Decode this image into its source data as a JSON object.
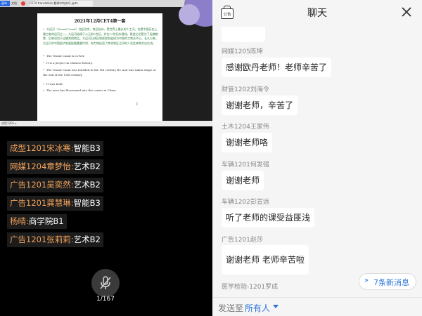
{
  "shared_screen": {
    "toolbar": {
      "file_tab": "画布",
      "tab1": "文档",
      "tab2": "CET4 translation 翻译中的技巧.pptx",
      "controls": "— □ ✕"
    },
    "slide": {
      "title": "2021年12月CET4第一套",
      "bullets": [
        "大运河（Grand Canal）北起北京，南至杭州，是世界上最长的人工河，也是中国历史上最古老的运河之一。大运河始建于公元前5世纪，并在13世纪末建成。建造之初是为了运输粮食，后来也用于运输其他商品。大运河沿线区域逐渐发展成为中国的工商业中心。长久以来，大运河对中国经济发展起着重要作用，有力地促进了南北地区之间的人员往来和文化交流。",
        "The Grand Canal is a river.",
        "It is a project in Chinese history.",
        "The Grand Canal was founded in the 5th century BC and was taken shape at the end of the 13th century.",
        "It was built.",
        "The area has blossomed into the center in China."
      ]
    },
    "video_bar_text": "成型1201 ▸"
  },
  "students": [
    {
      "name": "成型1201宋冰寒:",
      "value": " 智能B3"
    },
    {
      "name": "网媒1204章梦怡:",
      "value": " 艺术B2"
    },
    {
      "name": "广告1201吴奕然:",
      "value": " 艺术B2"
    },
    {
      "name": "广告1201龚慧琳:",
      "value": " 智能B3"
    },
    {
      "name": "杨晴:",
      "value": " 商学院B1"
    },
    {
      "name": "广告1201张莉莉:",
      "value": " 艺术B2"
    }
  ],
  "page_counter": "1/167",
  "chat": {
    "notice_label": "公告",
    "title": "聊天",
    "messages": [
      {
        "sender": "",
        "text": ""
      },
      {
        "sender": "网媒1205陈坤",
        "text": "感谢欧丹老师！老师辛苦了"
      },
      {
        "sender": "财管1202刘海令",
        "text": "谢谢老师，辛苦了"
      },
      {
        "sender": "土木1204王家伟",
        "text": "谢谢老师咯"
      },
      {
        "sender": "车辆1201何发强",
        "text": "谢谢老师"
      },
      {
        "sender": "车辆1202彭宣远",
        "text": "听了老师的课受益匪浅"
      },
      {
        "sender": "广告1201赵莎",
        "text": "谢谢老师 老师辛苦啦"
      },
      {
        "sender": "医学检验-1201罗成",
        "text": ""
      }
    ],
    "new_messages_label": "7条新消息",
    "send_label": "发送至",
    "send_target": "所有人"
  },
  "colors": {
    "student_name": "#f2a35c",
    "accent_blue": "#2a73d9"
  }
}
